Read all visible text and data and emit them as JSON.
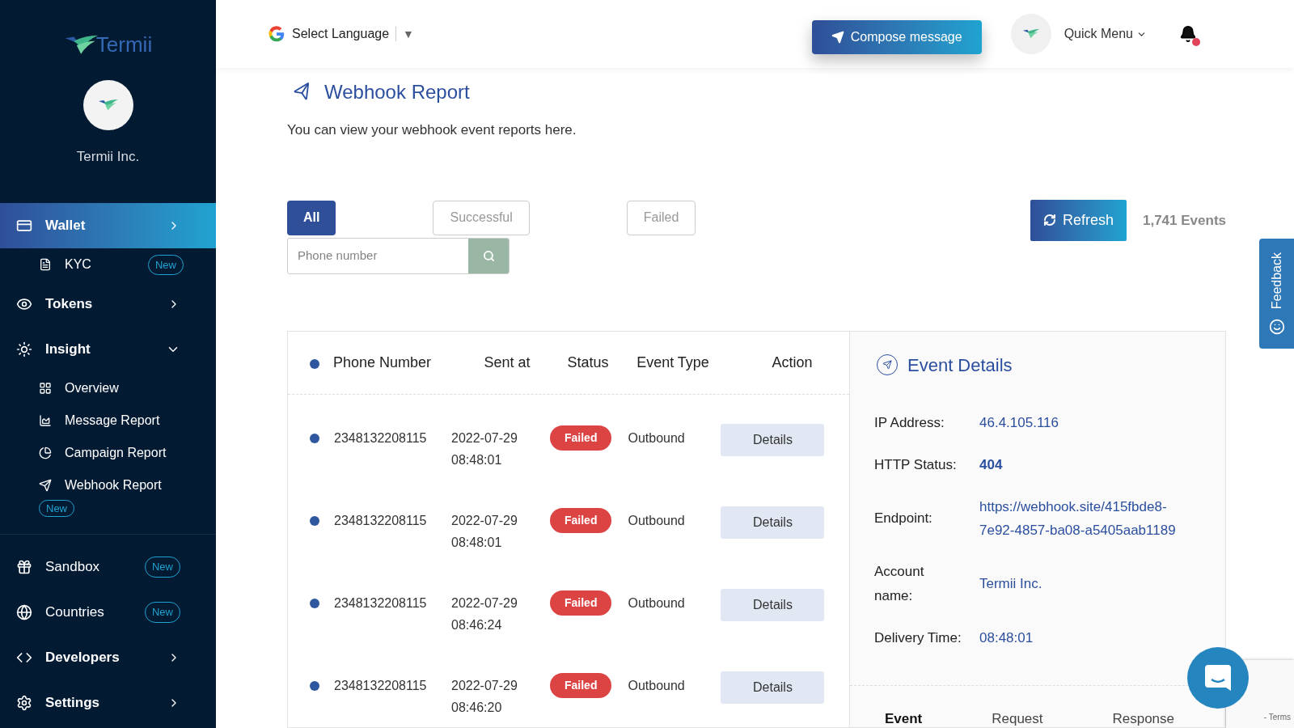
{
  "sidebar": {
    "brand": "Termii",
    "account_name": "Termii Inc.",
    "items": [
      {
        "kind": "main",
        "label": "Wallet",
        "selected": true,
        "expanded": false
      },
      {
        "kind": "sub",
        "label": "KYC",
        "badge": "New",
        "selected": false
      },
      {
        "kind": "main",
        "label": "Tokens",
        "selected": false,
        "expanded": false
      },
      {
        "kind": "main",
        "label": "Insight",
        "selected": false,
        "expanded": true,
        "children": [
          {
            "label": "Overview",
            "selected": false
          },
          {
            "label": "Message Report",
            "selected": false
          },
          {
            "label": "Campaign Report",
            "selected": false
          },
          {
            "label": "Webhook Report",
            "badge": "New",
            "selected": false
          }
        ]
      },
      {
        "kind": "divider"
      },
      {
        "kind": "plain",
        "label": "Sandbox",
        "badge": "New",
        "selected": false
      },
      {
        "kind": "plain",
        "label": "Countries",
        "badge": "New",
        "selected": false
      },
      {
        "kind": "main",
        "label": "Developers",
        "selected": false,
        "expanded": false
      },
      {
        "kind": "main",
        "label": "Settings",
        "selected": false,
        "expanded": false
      }
    ]
  },
  "header": {
    "language": "Select Language",
    "language_caret": "▼",
    "compose": "Compose message",
    "quick_menu": "Quick Menu",
    "notification_dot": true
  },
  "page": {
    "title": "Webhook Report",
    "subtitle": "You can view your webhook event reports here."
  },
  "filters": [
    {
      "label": "All",
      "selected": true
    },
    {
      "label": "Successful",
      "selected": false
    },
    {
      "label": "Failed",
      "selected": false
    }
  ],
  "search": {
    "placeholder": "Phone number"
  },
  "refresh": "Refresh",
  "event_count": "1,741 Events",
  "table": {
    "columns": [
      "Phone Number",
      "Sent at",
      "Status",
      "Event Type",
      "Action"
    ],
    "rows": [
      {
        "phone": "2348132208115",
        "date": "2022-07-29",
        "time": "08:48:01",
        "status": "Failed",
        "event_type": "Outbound",
        "action": "Details"
      },
      {
        "phone": "2348132208115",
        "date": "2022-07-29",
        "time": "08:48:01",
        "status": "Failed",
        "event_type": "Outbound",
        "action": "Details"
      },
      {
        "phone": "2348132208115",
        "date": "2022-07-29",
        "time": "08:46:24",
        "status": "Failed",
        "event_type": "Outbound",
        "action": "Details"
      },
      {
        "phone": "2348132208115",
        "date": "2022-07-29",
        "time": "08:46:20",
        "status": "Failed",
        "event_type": "Outbound",
        "action": "Details"
      }
    ]
  },
  "event_details": {
    "title": "Event Details",
    "fields": [
      {
        "label": "IP Address:",
        "value": "46.4.105.116",
        "strong": false
      },
      {
        "label": "HTTP Status:",
        "value": "404",
        "strong": true
      },
      {
        "label": "Endpoint:",
        "value": "https://webhook.site/415fbde8-7e92-4857-ba08-a5405aab1189",
        "strong": false
      },
      {
        "label": "Account name:",
        "value": "Termii Inc.",
        "strong": false
      },
      {
        "label": "Delivery Time:",
        "value": "08:48:01",
        "strong": false
      }
    ],
    "tabs": [
      {
        "label": "Event",
        "selected": true
      },
      {
        "label": "Request",
        "selected": false
      },
      {
        "label": "Response",
        "selected": false
      }
    ]
  },
  "feedback": "Feedback",
  "recaptcha": "- Terms"
}
